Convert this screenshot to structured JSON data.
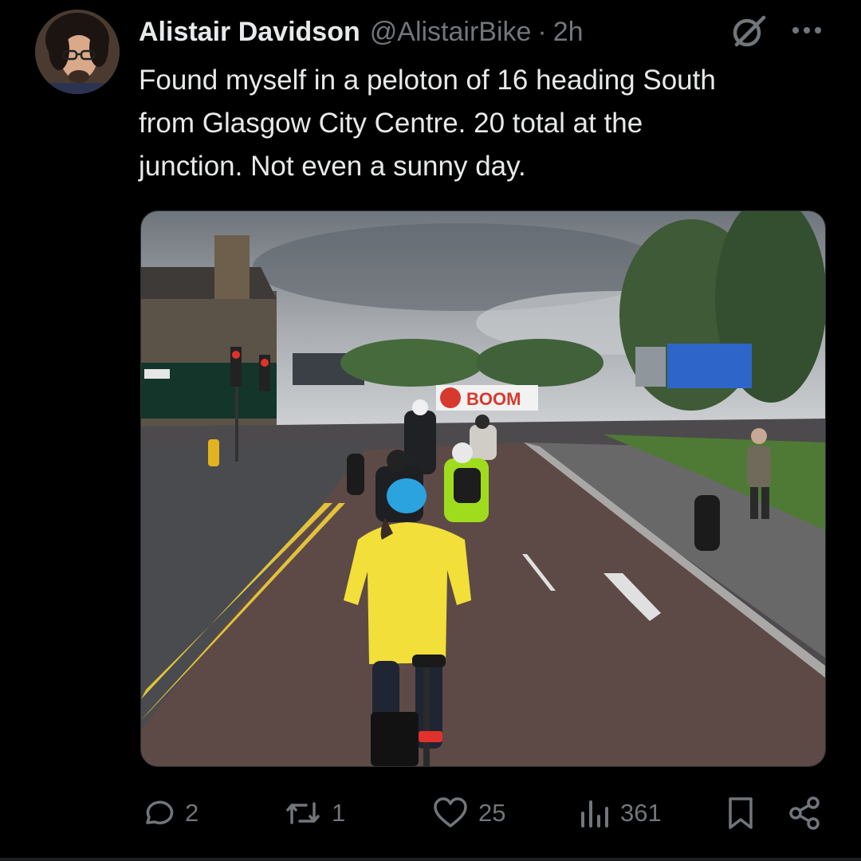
{
  "author": {
    "display_name": "Alistair Davidson",
    "handle": "@AlistairBike",
    "separator": "·",
    "time": "2h"
  },
  "tweet": {
    "text": "Found myself in a peloton of 16 heading South\nfrom Glasgow City Centre. 20 total at the\njunction. Not even a sunny day."
  },
  "media": {
    "billboard_brand": "BOOM"
  },
  "actions": {
    "replies": "2",
    "reposts": "1",
    "likes": "25",
    "views": "361"
  },
  "icons": [
    "grok-icon",
    "more-icon",
    "reply-icon",
    "repost-icon",
    "like-icon",
    "views-icon",
    "bookmark-icon",
    "share-icon"
  ],
  "colors": {
    "background": "#000000",
    "text": "#e7e9ea",
    "muted": "#71767b",
    "jacket_yellow": "#f2df3a",
    "helmet_blue": "#2aa3df"
  }
}
